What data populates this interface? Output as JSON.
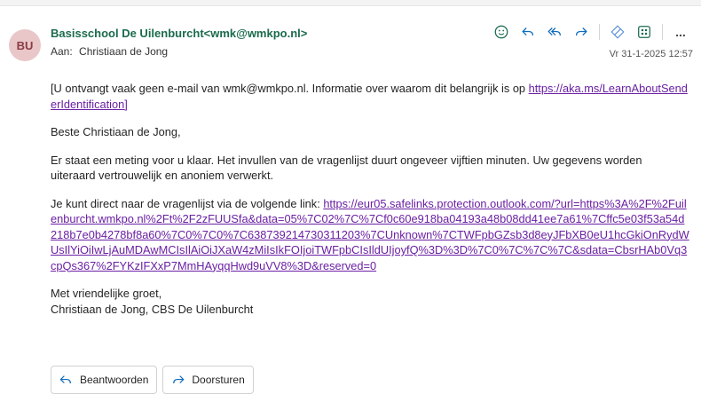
{
  "colors": {
    "accent": "#1b6b4c",
    "link": "#6a1fa3",
    "icon_blue": "#0f6cbd",
    "avatar_bg": "#e9c7c8"
  },
  "message": {
    "avatar_initials": "BU",
    "sender_name": "Basisschool De Uilenburcht",
    "sender_email": "<wmk@wmkpo.nl>",
    "to_label": "Aan:",
    "to_name": "Christiaan de Jong",
    "datetime": "Vr 31-1-2025 12:57"
  },
  "toolbar": {
    "icons": [
      "emoji-icon",
      "reply-icon",
      "reply-all-icon",
      "forward-icon",
      "loop-icon",
      "apps-icon",
      "more-icon"
    ],
    "more_label": "..."
  },
  "body": {
    "notice_text": "[U ontvangt vaak geen e-mail van wmk@wmkpo.nl. Informatie over waarom dit belangrijk is op ",
    "notice_link": "https://aka.ms/LearnAboutSenderIdentification]",
    "greeting": "Beste Christiaan de Jong,",
    "paragraph1": "Er staat een meting voor u klaar. Het invullen van de vragenlijst duurt ongeveer vijftien minuten. Uw gegevens worden uiteraard vertrouwelijk en anoniem verwerkt.",
    "paragraph2_text": "Je kunt direct naar de vragenlijst via de volgende link: ",
    "paragraph2_link": "https://eur05.safelinks.protection.outlook.com/?url=https%3A%2F%2Fuilenburcht.wmkpo.nl%2Ft%2F2zFUUSfa&data=05%7C02%7C%7Cf0c60e918ba04193a48b08dd41ee7a61%7Cffc5e03f53a54d218b7e0b4278bf8a60%7C0%7C0%7C638739214730311203%7CUnknown%7CTWFpbGZsb3d8eyJFbXB0eU1hcGkiOnRydWUsIlYiOiIwLjAuMDAwMCIsIlAiOiJXaW4zMiIsIkFOIjoiTWFpbCIsIldUIjoyfQ%3D%3D%7C0%7C%7C%7C&sdata=CbsrHAb0Vq3cpQs367%2FYKzIFXxP7MmHAyqqHwd9uVV8%3D&reserved=0",
    "closing": "Met vriendelijke groet,",
    "signature": "Christiaan de Jong, CBS De Uilenburcht"
  },
  "actions": {
    "reply_label": "Beantwoorden",
    "forward_label": "Doorsturen"
  }
}
